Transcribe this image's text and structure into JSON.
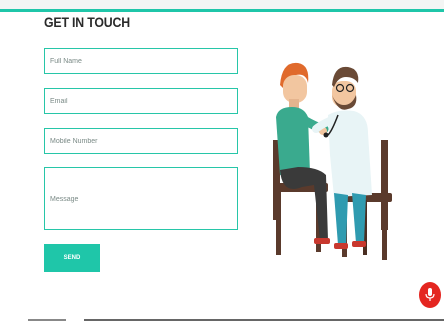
{
  "contact": {
    "title": "GET IN TOUCH",
    "fields": {
      "full_name_placeholder": "Full Name",
      "email_placeholder": "Email",
      "mobile_placeholder": "Mobile Number",
      "message_placeholder": "Message"
    },
    "send_label": "SEND"
  },
  "illustration": {
    "icon": "doctor-patient-illustration"
  },
  "fab": {
    "icon": "microphone-icon"
  },
  "colors": {
    "accent": "#1fc6a9",
    "fab": "#e42620",
    "title": "#2a2a2a"
  }
}
